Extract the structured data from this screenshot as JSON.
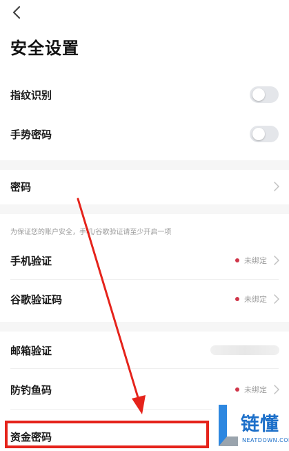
{
  "header": {
    "back_icon": "chevron-left-icon",
    "title": "安全设置"
  },
  "toggles": [
    {
      "label": "指纹识别",
      "enabled": false
    },
    {
      "label": "手势密码",
      "enabled": false
    }
  ],
  "password_row": {
    "label": "密码"
  },
  "hint_text": "为保证您的账户安全，手机/谷歌验证请至少开启一项",
  "verification_rows": [
    {
      "label": "手机验证",
      "status": "未绑定"
    },
    {
      "label": "谷歌验证码",
      "status": "未绑定"
    }
  ],
  "email_row": {
    "label": "邮箱验证"
  },
  "antiphishing_row": {
    "label": "防钓鱼码",
    "status": "未绑定"
  },
  "fund_password_row": {
    "label": "资金密码"
  },
  "watermark": {
    "brand": "链懂",
    "site": "NEATDOWN.COM"
  },
  "colors": {
    "status_dot": "#d0364a",
    "annotation": "#e5231b",
    "watermark": "#1c6fc9"
  }
}
